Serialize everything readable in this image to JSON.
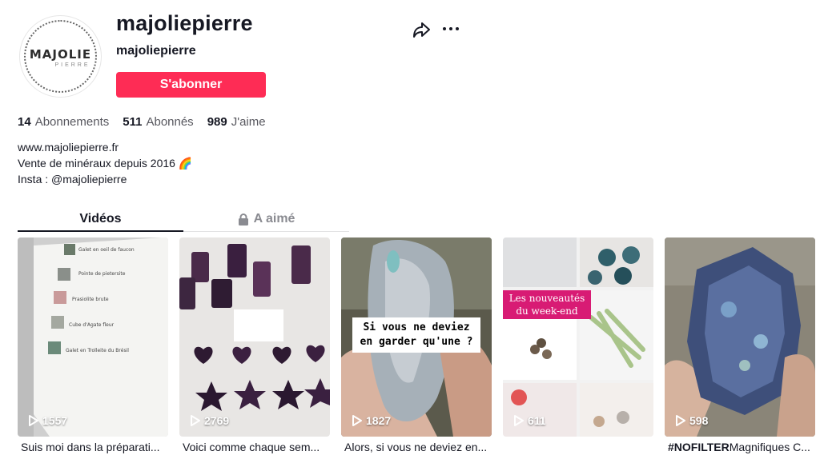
{
  "profile": {
    "username": "majoliepierre",
    "nickname": "majoliepierre",
    "avatar_logo": "MAJOLIE",
    "avatar_logo_sub": "PIERRE",
    "follow_label": "S'abonner",
    "icons": {
      "share": "share-arrow-icon",
      "more": "more-dots-icon"
    }
  },
  "stats": {
    "following": {
      "value": "14",
      "label": "Abonnements"
    },
    "followers": {
      "value": "511",
      "label": "Abonnés"
    },
    "likes": {
      "value": "989",
      "label": "J'aime"
    }
  },
  "bio": {
    "line1": "www.majoliepierre.fr",
    "line2": "Vente de minéraux depuis 2016 🌈",
    "line3": "Insta : @majoliepierre"
  },
  "tabs": {
    "videos": "Vidéos",
    "liked": "A aimé"
  },
  "videos": [
    {
      "views": "1557",
      "caption": "Suis moi dans la préparati...",
      "thumb_text": [
        "Galet en oeil de faucon",
        "Pointe de pietersite",
        "Prasiolite brute",
        "Cube d'Agate fleur",
        "Galet en Trolleite du Brésil"
      ]
    },
    {
      "views": "2769",
      "caption": "Voici comme chaque sem..."
    },
    {
      "views": "1827",
      "caption": "Alors, si vous ne deviez en...",
      "overlay": "Si vous ne deviez\nen garder qu'une ?"
    },
    {
      "views": "611",
      "caption": "",
      "overlay": "Les nouveautés\ndu week-end"
    },
    {
      "views": "598",
      "caption_bold": "#NOFILTER",
      "caption": "Magnifiques C..."
    }
  ],
  "colors": {
    "accent": "#fe2c55",
    "text": "#161823",
    "secondary": "#57575e",
    "pink_label": "#d81b74"
  }
}
